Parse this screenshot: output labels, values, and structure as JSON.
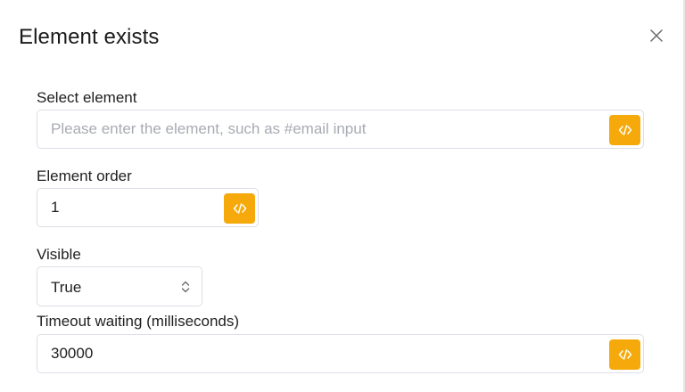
{
  "dialog": {
    "title": "Element exists",
    "close_icon": "close-icon"
  },
  "fields": {
    "select_element": {
      "label": "Select element",
      "value": "",
      "placeholder": "Please enter the element, such as #email input",
      "button_icon": "code-icon"
    },
    "element_order": {
      "label": "Element order",
      "value": "1",
      "button_icon": "code-icon"
    },
    "visible": {
      "label": "Visible",
      "selected": "True",
      "arrow_icon": "chevron-up-down-icon"
    },
    "timeout": {
      "label": "Timeout waiting (milliseconds)",
      "value": "30000",
      "button_icon": "code-icon"
    }
  },
  "colors": {
    "accent": "#f5a90a",
    "border": "#dcdfe6",
    "placeholder": "#a8abb2",
    "text": "#1f1f1f"
  }
}
